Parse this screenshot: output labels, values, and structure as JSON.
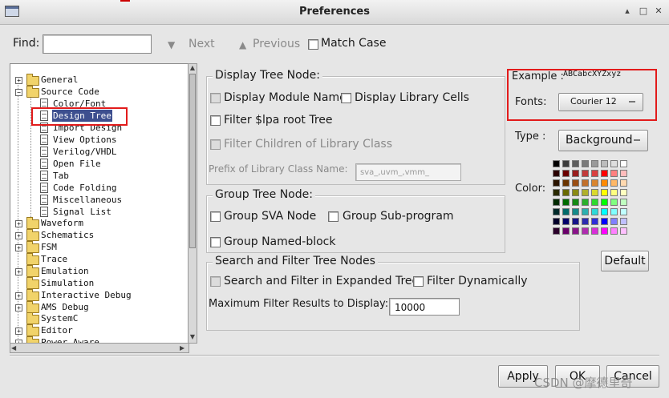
{
  "window": {
    "title": "Preferences",
    "controls": {
      "up": "▴",
      "restore": "□",
      "close": "✕"
    }
  },
  "find": {
    "label": "Find:",
    "value": "",
    "next_label": "Next",
    "previous_label": "Previous",
    "match_case_label": "Match Case"
  },
  "tree": {
    "items": [
      {
        "label": "General",
        "expander": "+"
      },
      {
        "label": "Source Code",
        "expander": "−"
      },
      {
        "label": "Color/Font"
      },
      {
        "label": "Design Tree"
      },
      {
        "label": "Import Design"
      },
      {
        "label": "View Options"
      },
      {
        "label": "Verilog/VHDL"
      },
      {
        "label": "Open File"
      },
      {
        "label": "Tab"
      },
      {
        "label": "Code Folding"
      },
      {
        "label": "Miscellaneous"
      },
      {
        "label": "Signal List"
      },
      {
        "label": "Waveform",
        "expander": "+"
      },
      {
        "label": "Schematics",
        "expander": "+"
      },
      {
        "label": "FSM",
        "expander": "+"
      },
      {
        "label": "Trace"
      },
      {
        "label": "Emulation",
        "expander": "+"
      },
      {
        "label": "Simulation"
      },
      {
        "label": "Interactive Debug",
        "expander": "+"
      },
      {
        "label": "AMS Debug",
        "expander": "+"
      },
      {
        "label": "SystemC"
      },
      {
        "label": "Editor",
        "expander": "+"
      },
      {
        "label": "Power Aware",
        "expander": "+"
      }
    ],
    "selected": "Design Tree"
  },
  "display_tree_node": {
    "title": "Display Tree Node:",
    "display_module_name": "Display Module Name",
    "display_library_cells": "Display Library Cells",
    "filter_lpa_root": "Filter $lpa  root Tree",
    "filter_children": "Filter Children of Library Class",
    "prefix_label": "Prefix of Library Class Name:",
    "prefix_value": "sva_,uvm_,vmm_"
  },
  "group_tree_node": {
    "title": "Group Tree Node:",
    "group_sva_node": "Group SVA Node",
    "group_sub_program": "Group Sub-program",
    "group_named_block": "Group Named-block"
  },
  "search_filter": {
    "title": "Search and Filter Tree Nodes",
    "search_expanded": "Search and Filter in Expanded Tree",
    "filter_dynamically": "Filter Dynamically",
    "max_results_label": "Maximum Filter Results to Display:",
    "max_results_value": "10000"
  },
  "font_panel": {
    "example_label": "Example :",
    "example_text": "ABCabcXYZxyz",
    "fonts_label": "Fonts:",
    "font_value": "Courier 12",
    "type_label": "Type :",
    "type_value": "Background",
    "color_label": "Color:",
    "default_label": "Default"
  },
  "palette": [
    [
      "#000000",
      "#3c3c3c",
      "#5c5c5c",
      "#7a7a7a",
      "#9a9a9a",
      "#bcbcbc",
      "#dedede",
      "#ffffff"
    ],
    [
      "#2a0000",
      "#6a0000",
      "#9a1e1e",
      "#c23b3b",
      "#d94040",
      "#ff0000",
      "#ff8080",
      "#ffbcbc"
    ],
    [
      "#2a1400",
      "#6a3400",
      "#9a4e14",
      "#c2702b",
      "#d9852e",
      "#ff8a00",
      "#ffb866",
      "#ffd9b0"
    ],
    [
      "#2a2a00",
      "#6a6a00",
      "#8a8a14",
      "#b0b02b",
      "#d9d92e",
      "#ffff00",
      "#ffff80",
      "#ffffc0"
    ],
    [
      "#002a00",
      "#006a00",
      "#148a14",
      "#2bb02b",
      "#2ed92e",
      "#00ff00",
      "#80ff80",
      "#c0ffc0"
    ],
    [
      "#002a2a",
      "#006a6a",
      "#148a8a",
      "#2bb0b0",
      "#2ed9d9",
      "#00ffff",
      "#80ffff",
      "#c0ffff"
    ],
    [
      "#00002a",
      "#00006a",
      "#14148a",
      "#2b2bb0",
      "#2e2ed9",
      "#0000ff",
      "#8080ff",
      "#c0c0ff"
    ],
    [
      "#2a002a",
      "#6a006a",
      "#8a148a",
      "#b02bb0",
      "#d92ed9",
      "#ff00ff",
      "#ff80ff",
      "#ffc0ff"
    ]
  ],
  "buttons": {
    "apply": "Apply",
    "ok": "OK",
    "cancel": "Cancel"
  },
  "watermark": "CSDN @摩德里奇"
}
